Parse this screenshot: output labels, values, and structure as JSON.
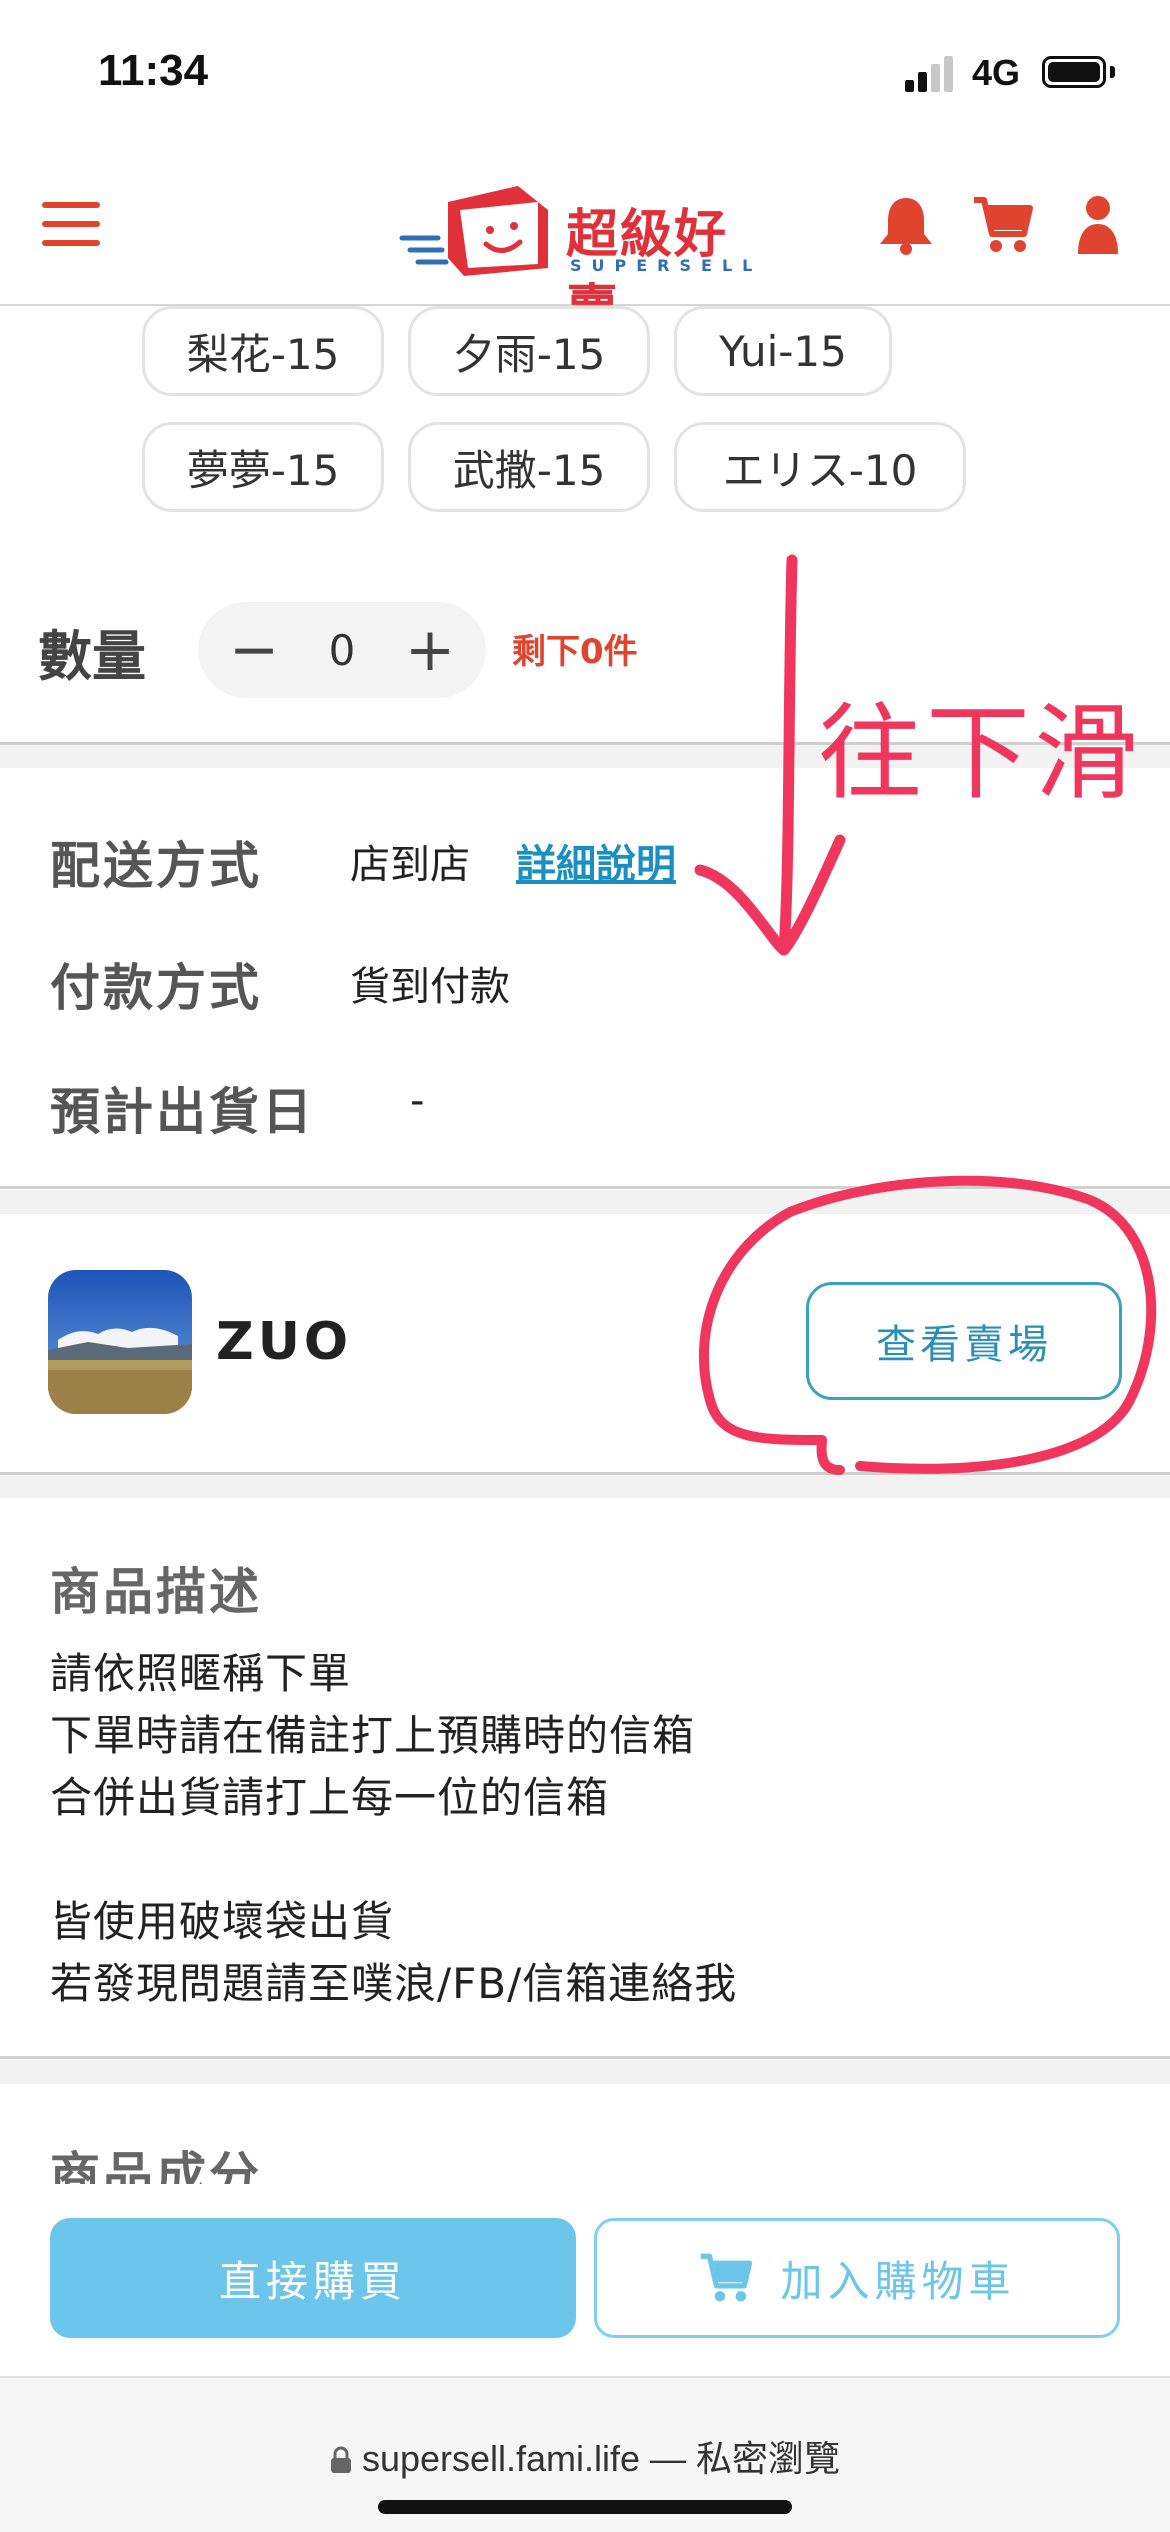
{
  "status_bar": {
    "time": "11:34",
    "network": "4G"
  },
  "header": {
    "logo_text": "超級好賣",
    "logo_sub": "SUPERSELL",
    "icons": [
      "menu-icon",
      "bell-icon",
      "cart-icon",
      "user-icon"
    ],
    "accent_color": "#e0442e"
  },
  "tags": [
    "梨花-15",
    "夕雨-15",
    "Yui-15",
    "夢夢-15",
    "武撒-15",
    "エリス-10"
  ],
  "quantity": {
    "label": "數量",
    "minus": "−",
    "value": "0",
    "plus": "+",
    "remaining": "剩下0件"
  },
  "delivery": {
    "method_label": "配送方式",
    "method_value": "店到店",
    "method_link": "詳細說明",
    "payment_label": "付款方式",
    "payment_value": "貨到付款",
    "ship_date_label": "預計出貨日",
    "ship_date_value": "-"
  },
  "seller": {
    "name": "ZUO",
    "view_store_label": "查看賣場"
  },
  "description": {
    "title": "商品描述",
    "lines": [
      "請依照暱稱下單",
      "下單時請在備註打上預購時的信箱",
      "合併出貨請打上每一位的信箱",
      "",
      "皆使用破壞袋出貨",
      "若發現問題請至噗浪/FB/信箱連絡我"
    ]
  },
  "ingredients": {
    "title": "商品成分"
  },
  "actions": {
    "buy_now_label": "直接購買",
    "add_cart_label": "加入購物車"
  },
  "browser": {
    "url": "supersell.fami.life — 私密瀏覽"
  },
  "annotation": {
    "text": "往下滑",
    "color": "#f0365c"
  }
}
